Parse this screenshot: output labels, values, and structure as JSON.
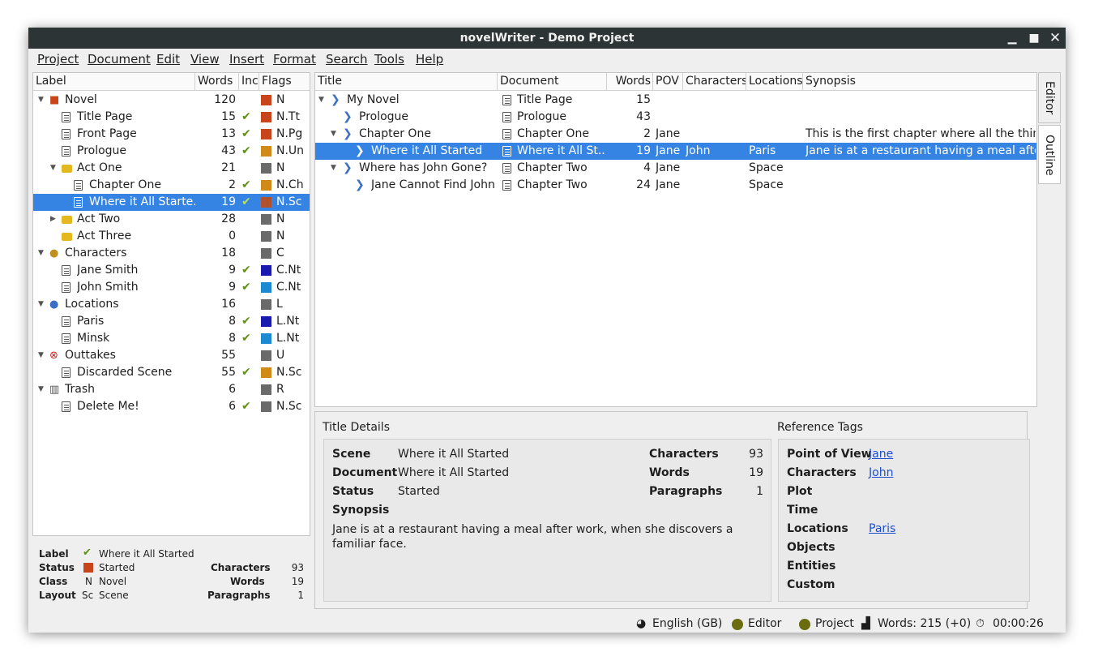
{
  "window": {
    "title": "novelWriter - Demo Project"
  },
  "menu": [
    "Project",
    "Document",
    "Edit",
    "View",
    "Insert",
    "Format",
    "Search",
    "Tools",
    "Help"
  ],
  "project_tree": {
    "columns": [
      "Label",
      "Words",
      "Inc",
      "Flags"
    ],
    "rows": [
      {
        "label": "Novel",
        "words": "120",
        "inc": "",
        "flag": "N",
        "color": "#c8451c",
        "icon": "novel-icon",
        "indent": 0,
        "arrow": "down"
      },
      {
        "label": "Title Page",
        "words": "15",
        "inc": "✔",
        "flag": "N.Tt",
        "color": "#c8451c",
        "icon": "document-icon",
        "indent": 1,
        "arrow": ""
      },
      {
        "label": "Front Page",
        "words": "13",
        "inc": "✔",
        "flag": "N.Pg",
        "color": "#c8451c",
        "icon": "document-icon",
        "indent": 1,
        "arrow": ""
      },
      {
        "label": "Prologue",
        "words": "43",
        "inc": "✔",
        "flag": "N.Un",
        "color": "#d08a18",
        "icon": "document-icon",
        "indent": 1,
        "arrow": ""
      },
      {
        "label": "Act One",
        "words": "21",
        "inc": "",
        "flag": "N",
        "color": "#6a6a6a",
        "icon": "folder-icon",
        "indent": 1,
        "arrow": "down"
      },
      {
        "label": "Chapter One",
        "words": "2",
        "inc": "✔",
        "flag": "N.Ch",
        "color": "#d08a18",
        "icon": "document-icon",
        "indent": 2,
        "arrow": ""
      },
      {
        "label": "Where it All Starte...",
        "words": "19",
        "inc": "✔",
        "flag": "N.Sc",
        "color": "#b0522e",
        "icon": "document-icon",
        "indent": 2,
        "arrow": "",
        "selected": true
      },
      {
        "label": "Act Two",
        "words": "28",
        "inc": "",
        "flag": "N",
        "color": "#6a6a6a",
        "icon": "folder-icon",
        "indent": 1,
        "arrow": "right"
      },
      {
        "label": "Act Three",
        "words": "0",
        "inc": "",
        "flag": "N",
        "color": "#6a6a6a",
        "icon": "folder-icon",
        "indent": 1,
        "arrow": ""
      },
      {
        "label": "Characters",
        "words": "18",
        "inc": "",
        "flag": "C",
        "color": "#6a6a6a",
        "icon": "character-icon",
        "indent": 0,
        "arrow": "down"
      },
      {
        "label": "Jane Smith",
        "words": "9",
        "inc": "✔",
        "flag": "C.Nt",
        "color": "#1a1ab0",
        "icon": "document-icon",
        "indent": 1,
        "arrow": ""
      },
      {
        "label": "John Smith",
        "words": "9",
        "inc": "✔",
        "flag": "C.Nt",
        "color": "#1c8ad0",
        "icon": "document-icon",
        "indent": 1,
        "arrow": ""
      },
      {
        "label": "Locations",
        "words": "16",
        "inc": "",
        "flag": "L",
        "color": "#6a6a6a",
        "icon": "location-icon",
        "indent": 0,
        "arrow": "down"
      },
      {
        "label": "Paris",
        "words": "8",
        "inc": "✔",
        "flag": "L.Nt",
        "color": "#1a1ab0",
        "icon": "document-icon",
        "indent": 1,
        "arrow": ""
      },
      {
        "label": "Minsk",
        "words": "8",
        "inc": "✔",
        "flag": "L.Nt",
        "color": "#1c8ad0",
        "icon": "document-icon",
        "indent": 1,
        "arrow": ""
      },
      {
        "label": "Outtakes",
        "words": "55",
        "inc": "",
        "flag": "U",
        "color": "#6a6a6a",
        "icon": "outtakes-icon",
        "indent": 0,
        "arrow": "down"
      },
      {
        "label": "Discarded Scene",
        "words": "55",
        "inc": "✔",
        "flag": "N.Sc",
        "color": "#d08a18",
        "icon": "document-icon",
        "indent": 1,
        "arrow": ""
      },
      {
        "label": "Trash",
        "words": "6",
        "inc": "",
        "flag": "R",
        "color": "#6a6a6a",
        "icon": "trash-icon",
        "indent": 0,
        "arrow": "down"
      },
      {
        "label": "Delete Me!",
        "words": "6",
        "inc": "✔",
        "flag": "N.Sc",
        "color": "#6a6a6a",
        "icon": "document-icon",
        "indent": 1,
        "arrow": ""
      }
    ]
  },
  "item_details": {
    "label_lbl": "Label",
    "label_val": "Where it All Started",
    "status_lbl": "Status",
    "status_val": "Started",
    "status_color": "#c8451c",
    "class_lbl": "Class",
    "class_code": "N",
    "class_val": "Novel",
    "layout_lbl": "Layout",
    "layout_code": "Sc",
    "layout_val": "Scene",
    "characters_lbl": "Characters",
    "characters_val": "93",
    "words_lbl": "Words",
    "words_val": "19",
    "paragraphs_lbl": "Paragraphs",
    "paragraphs_val": "1"
  },
  "outline": {
    "columns": [
      "Title",
      "Document",
      "Words",
      "POV",
      "Characters",
      "Locations",
      "Synopsis"
    ],
    "rows": [
      {
        "title": "My Novel",
        "document": "Title Page",
        "words": "15",
        "pov": "",
        "characters": "",
        "locations": "",
        "synopsis": "",
        "indent": 0,
        "arrow": "down"
      },
      {
        "title": "Prologue",
        "document": "Prologue",
        "words": "43",
        "pov": "",
        "characters": "",
        "locations": "",
        "synopsis": "",
        "indent": 1,
        "arrow": ""
      },
      {
        "title": "Chapter One",
        "document": "Chapter One",
        "words": "2",
        "pov": "Jane",
        "characters": "",
        "locations": "",
        "synopsis": "This is the first chapter where all the thin...",
        "indent": 1,
        "arrow": "down"
      },
      {
        "title": "Where it All Started",
        "document": "Where it All St...",
        "words": "19",
        "pov": "Jane",
        "characters": "John",
        "locations": "Paris",
        "synopsis": "Jane is at a restaurant having a meal afte...",
        "indent": 2,
        "arrow": "",
        "selected": true
      },
      {
        "title": "Where has John Gone?",
        "document": "Chapter Two",
        "words": "4",
        "pov": "Jane",
        "characters": "",
        "locations": "Space",
        "synopsis": "",
        "indent": 1,
        "arrow": "down"
      },
      {
        "title": "Jane Cannot Find John",
        "document": "Chapter Two",
        "words": "24",
        "pov": "Jane",
        "characters": "",
        "locations": "Space",
        "synopsis": "",
        "indent": 2,
        "arrow": ""
      }
    ]
  },
  "title_details": {
    "heading": "Title Details",
    "scene_lbl": "Scene",
    "scene_val": "Where it All Started",
    "document_lbl": "Document",
    "document_val": "Where it All Started",
    "status_lbl": "Status",
    "status_val": "Started",
    "synopsis_lbl": "Synopsis",
    "synopsis_val": "Jane is at a restaurant having a meal after work, when she discovers a familiar face.",
    "characters_lbl": "Characters",
    "characters_val": "93",
    "words_lbl": "Words",
    "words_val": "19",
    "paragraphs_lbl": "Paragraphs",
    "paragraphs_val": "1"
  },
  "reference_tags": {
    "heading": "Reference Tags",
    "pov_lbl": "Point of View",
    "pov_val": "Jane",
    "characters_lbl": "Characters",
    "characters_val": "John",
    "plot_lbl": "Plot",
    "time_lbl": "Time",
    "locations_lbl": "Locations",
    "locations_val": "Paris",
    "objects_lbl": "Objects",
    "entities_lbl": "Entities",
    "custom_lbl": "Custom"
  },
  "side_tabs": {
    "editor": "Editor",
    "outline": "Outline"
  },
  "statusbar": {
    "language": "English (GB)",
    "editor": "Editor",
    "project": "Project",
    "words": "Words: 215 (+0)",
    "time": "00:00:26",
    "indicator_color": "#6b6b10"
  }
}
